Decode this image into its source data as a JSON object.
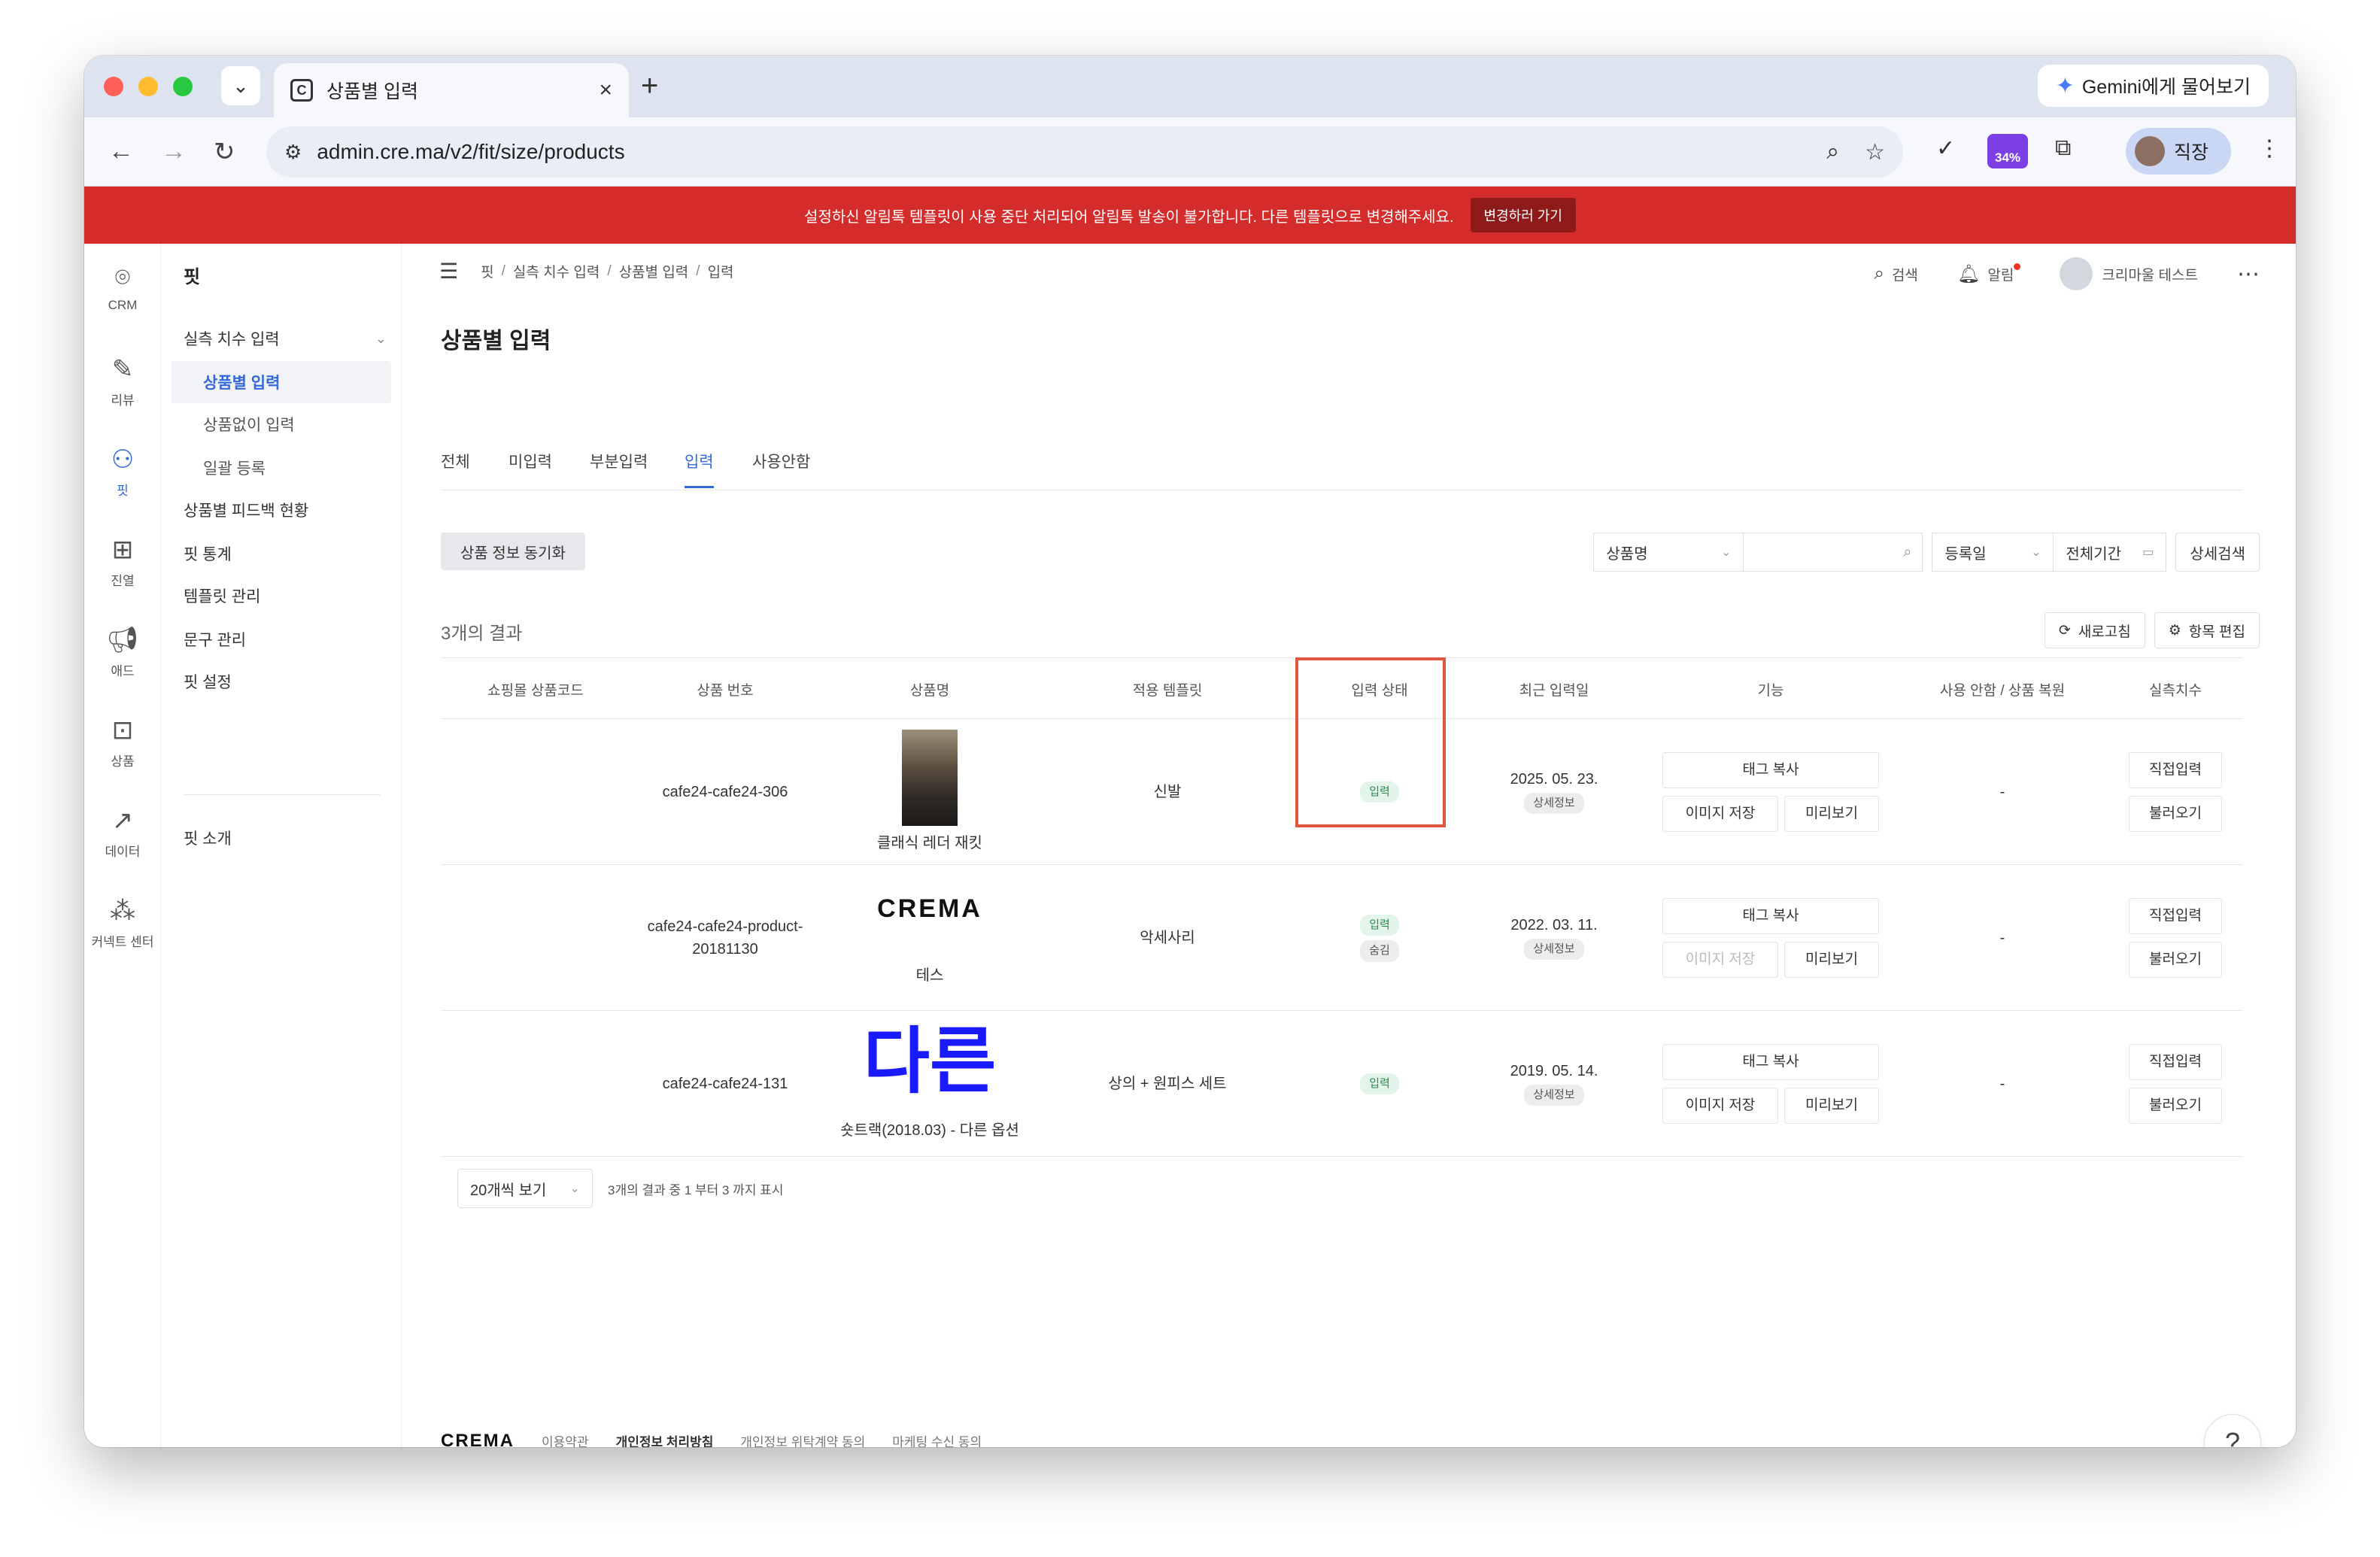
{
  "browser": {
    "tab_title": "상품별 입력",
    "favicon_letter": "C",
    "gemini_label": "Gemini에게 물어보기",
    "url": "admin.cre.ma/v2/fit/size/products",
    "extension_badge": "34%",
    "profile_name": "직장"
  },
  "banner": {
    "message": "설정하신 알림톡 템플릿이 사용 중단 처리되어 알림톡 발송이 불가합니다. 다른 템플릿으로 변경해주세요.",
    "button": "변경하러 가기"
  },
  "rail": [
    {
      "icon": "location-pin-icon",
      "label": "CRM"
    },
    {
      "icon": "edit-icon",
      "label": "리뷰"
    },
    {
      "icon": "user-check-icon",
      "label": "핏"
    },
    {
      "icon": "grid-icon",
      "label": "진열"
    },
    {
      "icon": "megaphone-icon",
      "label": "애드"
    },
    {
      "icon": "bag-icon",
      "label": "상품"
    },
    {
      "icon": "chart-icon",
      "label": "데이터"
    },
    {
      "icon": "connect-icon",
      "label": "커넥트 센터"
    }
  ],
  "sidebar": {
    "title": "핏",
    "items": [
      {
        "label": "실측 치수 입력"
      },
      {
        "label": "상품별 입력"
      },
      {
        "label": "상품없이 입력"
      },
      {
        "label": "일괄 등록"
      },
      {
        "label": "상품별 피드백 현황"
      },
      {
        "label": "핏 통계"
      },
      {
        "label": "템플릿 관리"
      },
      {
        "label": "문구 관리"
      },
      {
        "label": "핏 설정"
      },
      {
        "label": "핏 소개"
      }
    ]
  },
  "breadcrumb": [
    "핏",
    "실측 치수 입력",
    "상품별 입력",
    "입력"
  ],
  "topbar": {
    "search": "검색",
    "alarm": "알림",
    "user": "크리마울 테스트"
  },
  "page_title": "상품별 입력",
  "tabs": [
    "전체",
    "미입력",
    "부분입력",
    "입력",
    "사용안함"
  ],
  "active_tab": "입력",
  "sync_button": "상품 정보 동기화",
  "filters": {
    "search_field": "상품명",
    "search_value": "",
    "date_field": "등록일",
    "period": "전체기간",
    "detail_search": "상세검색"
  },
  "results_count": "3개의 결과",
  "actions": {
    "refresh": "새로고침",
    "edit_columns": "항목 편집"
  },
  "columns": [
    "쇼핑몰 상품코드",
    "상품 번호",
    "상품명",
    "적용 템플릿",
    "입력 상태",
    "최근 입력일",
    "기능",
    "사용 안함 / 상품 복원",
    "실측치수"
  ],
  "rows": [
    {
      "code": "",
      "number": "cafe24-cafe24-306",
      "thumb_type": "photo",
      "name": "클래식 레더 재킷",
      "template": "신발",
      "status": [
        "입력"
      ],
      "date": "2025. 05. 23.",
      "detail": "상세정보",
      "tag_copy": "태그 복사",
      "save_image": "이미지 저장",
      "save_image_disabled": false,
      "preview": "미리보기",
      "restore": "-",
      "direct_input": "직접입력",
      "load": "불러오기"
    },
    {
      "code": "",
      "number": "cafe24-cafe24-product-20181130",
      "thumb_type": "logo",
      "thumb_text": "CREMA",
      "name": "테스",
      "template": "악세사리",
      "status": [
        "입력",
        "숨김"
      ],
      "date": "2022. 03. 11.",
      "detail": "상세정보",
      "tag_copy": "태그 복사",
      "save_image": "이미지 저장",
      "save_image_disabled": true,
      "preview": "미리보기",
      "restore": "-",
      "direct_input": "직접입력",
      "load": "불러오기"
    },
    {
      "code": "",
      "number": "cafe24-cafe24-131",
      "thumb_type": "text",
      "thumb_text": "다른",
      "name": "숏트랙(2018.03) - 다른 옵션",
      "template": "상의 + 원피스 세트",
      "status": [
        "입력"
      ],
      "date": "2019. 05. 14.",
      "detail": "상세정보",
      "tag_copy": "태그 복사",
      "save_image": "이미지 저장",
      "save_image_disabled": false,
      "preview": "미리보기",
      "restore": "-",
      "direct_input": "직접입력",
      "load": "불러오기"
    }
  ],
  "pager": {
    "per_page": "20개씩 보기",
    "summary": "3개의 결과 중 1 부터 3 까지 표시"
  },
  "footer": {
    "logo": "CREMA",
    "links": [
      "이용약관",
      "개인정보 처리방침",
      "개인정보 위탁계약 동의",
      "마케팅 수신 동의"
    ]
  },
  "help": "?"
}
